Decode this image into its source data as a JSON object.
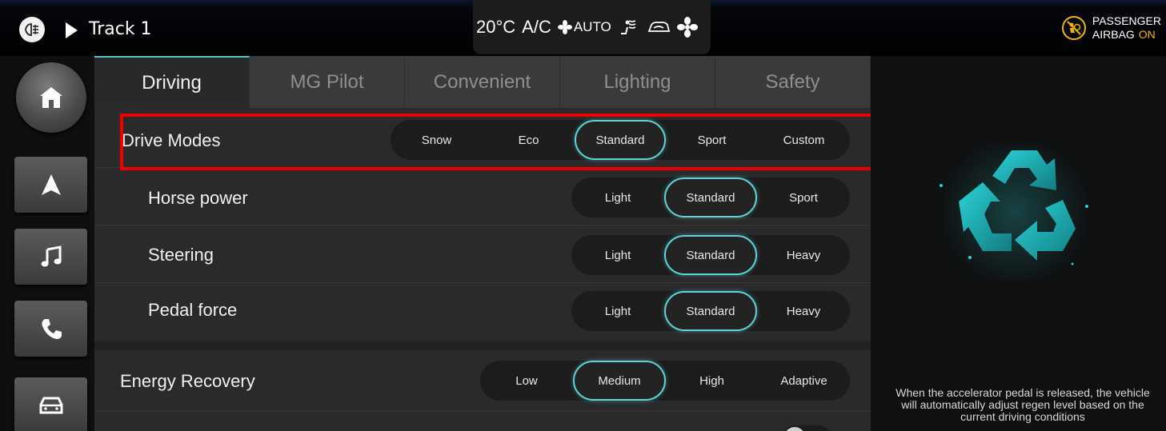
{
  "status_bar": {
    "media_icon": "front-fog-light-icon",
    "track_title": "Track 1",
    "climate": {
      "temperature": "20°C",
      "ac": "A/C",
      "fan_mode": "AUTO"
    },
    "airbag": {
      "line1": "PASSENGER",
      "line2": "AIRBAG",
      "state": "ON",
      "state_color": "#f2b400"
    }
  },
  "nav": {
    "items": [
      "home-icon",
      "navigation-icon",
      "music-icon",
      "phone-icon",
      "car-icon"
    ]
  },
  "tabs": [
    {
      "label": "Driving",
      "active": true
    },
    {
      "label": "MG Pilot",
      "active": false
    },
    {
      "label": "Convenient",
      "active": false
    },
    {
      "label": "Lighting",
      "active": false
    },
    {
      "label": "Safety",
      "active": false
    }
  ],
  "settings": {
    "drive_modes": {
      "label": "Drive Modes",
      "options": [
        "Snow",
        "Eco",
        "Standard",
        "Sport",
        "Custom"
      ],
      "selected": "Standard"
    },
    "horse_power": {
      "label": "Horse power",
      "options": [
        "Light",
        "Standard",
        "Sport"
      ],
      "selected": "Standard"
    },
    "steering": {
      "label": "Steering",
      "options": [
        "Light",
        "Standard",
        "Heavy"
      ],
      "selected": "Standard"
    },
    "pedal_force": {
      "label": "Pedal force",
      "options": [
        "Light",
        "Standard",
        "Heavy"
      ],
      "selected": "Standard"
    },
    "energy_recovery": {
      "label": "Energy Recovery",
      "options": [
        "Low",
        "Medium",
        "High",
        "Adaptive"
      ],
      "selected": "Medium"
    }
  },
  "info_panel": {
    "icon": "recycle-icon",
    "description": "When the accelerator pedal is released, the vehicle will automatically adjust regen level based on the current driving conditions"
  },
  "colors": {
    "accent": "#5fd3d6",
    "highlight_box": "#ee0000"
  }
}
